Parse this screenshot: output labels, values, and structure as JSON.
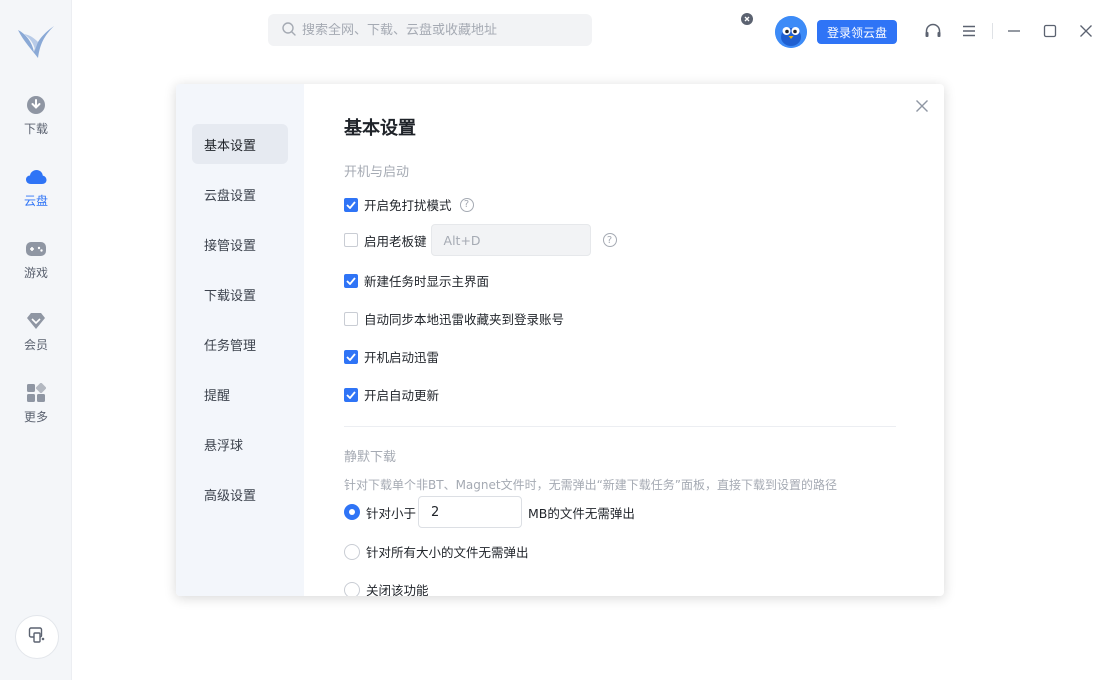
{
  "nav": {
    "items": [
      {
        "label": "下载",
        "icon": "download-icon"
      },
      {
        "label": "云盘",
        "icon": "cloud-icon"
      },
      {
        "label": "游戏",
        "icon": "gamepad-icon"
      },
      {
        "label": "会员",
        "icon": "diamond-icon"
      },
      {
        "label": "更多",
        "icon": "grid-icon"
      }
    ],
    "active": "云盘"
  },
  "topbar": {
    "search_placeholder": "搜索全网、下载、云盘或收藏地址",
    "login_label": "登录领云盘"
  },
  "colors": {
    "accent": "#2f74f6",
    "sidebar_bg": "#f3f6fb"
  },
  "settings": {
    "side_items": [
      "基本设置",
      "云盘设置",
      "接管设置",
      "下载设置",
      "任务管理",
      "提醒",
      "悬浮球",
      "高级设置"
    ],
    "active_item": "基本设置",
    "title": "基本设置",
    "startup": {
      "section_title": "开机与启动",
      "options": [
        {
          "label": "开启免打扰模式",
          "checked": true
        },
        {
          "label": "启用老板键",
          "checked": false,
          "hotkey": "Alt+D"
        },
        {
          "label": "新建任务时显示主界面",
          "checked": true
        },
        {
          "label": "自动同步本地迅雷收藏夹到登录账号",
          "checked": false
        },
        {
          "label": "开机启动迅雷",
          "checked": true
        },
        {
          "label": "开启自动更新",
          "checked": true
        }
      ]
    },
    "silent": {
      "section_title": "静默下载",
      "description": "针对下载单个非BT、Magnet文件时，无需弹出“新建下载任务”面板，直接下载到设置的路径",
      "option_small_prefix": "针对小于",
      "option_small_value": "2",
      "option_small_suffix": "MB的文件无需弹出",
      "option_all": "针对所有大小的文件无需弹出",
      "option_off": "关闭该功能",
      "selected": "small"
    }
  }
}
